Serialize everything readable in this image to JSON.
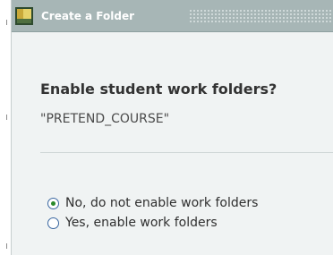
{
  "dialog": {
    "title": "Create a Folder",
    "question": "Enable student work folders?",
    "course_name": "\"PRETEND_COURSE\"",
    "options": [
      {
        "label": "No, do not enable work folders",
        "selected": true
      },
      {
        "label": "Yes, enable work folders",
        "selected": false
      }
    ]
  },
  "icons": {
    "title_icon": "folder-icon"
  },
  "colors": {
    "titlebar_bg": "#a7b6b6",
    "dialog_bg": "#f0f3f3",
    "radio_selected": "#2a8a2a",
    "radio_border": "#3a67a0"
  }
}
